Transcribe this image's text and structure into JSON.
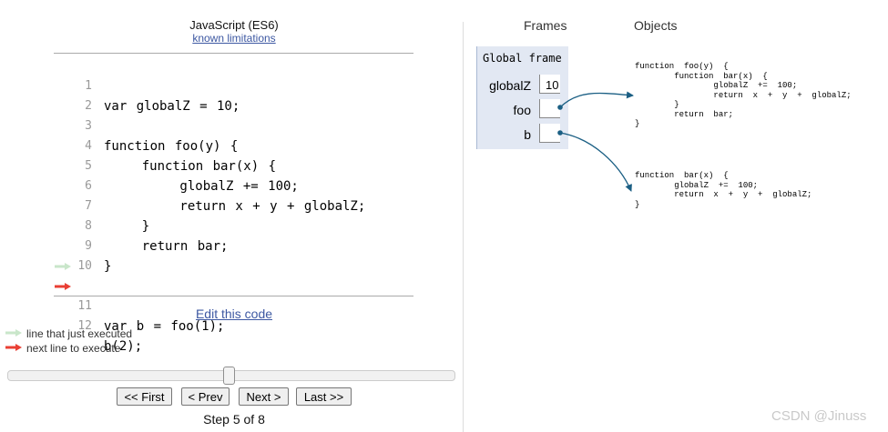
{
  "code_panel": {
    "language": "JavaScript (ES6)",
    "limitations_link": "known limitations",
    "lines": [
      {
        "num": "1",
        "code": "var globalZ = 10;"
      },
      {
        "num": "2",
        "code": ""
      },
      {
        "num": "3",
        "code": "function foo(y) {"
      },
      {
        "num": "4",
        "code": "    function bar(x) {"
      },
      {
        "num": "5",
        "code": "        globalZ += 100;"
      },
      {
        "num": "6",
        "code": "        return x + y + globalZ;"
      },
      {
        "num": "7",
        "code": "    }"
      },
      {
        "num": "8",
        "code": "    return bar;"
      },
      {
        "num": "9",
        "code": "}"
      },
      {
        "num": "10",
        "code": ""
      },
      {
        "num": "11",
        "code": "var b = foo(1);"
      },
      {
        "num": "12",
        "code": "b(2);"
      }
    ],
    "just_executed_line": 11,
    "next_line": 12,
    "edit_link": "Edit this code"
  },
  "legend": {
    "just_executed": "line that just executed",
    "next_to_execute": "next line to execute"
  },
  "navigation": {
    "first": "<< First",
    "prev": "< Prev",
    "next": "Next >",
    "last": "Last >>",
    "step_text": "Step 5 of 8",
    "step_current": 5,
    "step_total": 8
  },
  "visualization": {
    "frames_header": "Frames",
    "objects_header": "Objects",
    "global_frame": {
      "title": "Global frame",
      "variables": [
        {
          "name": "globalZ",
          "value": "10"
        },
        {
          "name": "foo",
          "value": ""
        },
        {
          "name": "b",
          "value": ""
        }
      ]
    },
    "objects": [
      {
        "code": "function  foo(y)  {\n        function  bar(x)  {\n                globalZ  +=  100;\n                return  x  +  y  +  globalZ;\n        }\n        return  bar;\n}"
      },
      {
        "code": "function  bar(x)  {\n        globalZ  +=  100;\n        return  x  +  y  +  globalZ;\n}"
      }
    ]
  },
  "colors": {
    "just_executed_arrow": "#c9e6ca",
    "next_arrow": "#e93f34",
    "pointer": "#1b5f84",
    "frame_bg": "#e2e8f3",
    "link": "#3d58a2"
  },
  "watermark": "CSDN @Jinuss"
}
